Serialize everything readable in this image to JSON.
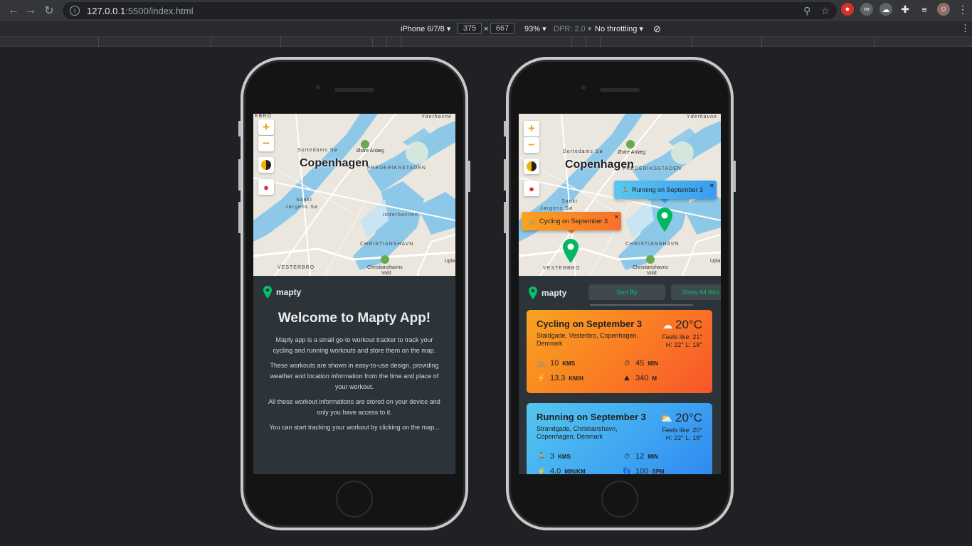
{
  "browser": {
    "url_host": "127.0.0.1",
    "url_rest": ":5500/index.html"
  },
  "devtools": {
    "device": "iPhone 6/7/8",
    "width": "375",
    "times": "×",
    "height": "667",
    "zoom": "93%",
    "dpr": "DPR: 2.0",
    "throttling": "No throttling"
  },
  "map": {
    "city": "Copenhagen",
    "zoom_in": "+",
    "zoom_out": "−",
    "labels": {
      "sortedams": "Sortedams Sø",
      "ostre": "Østre Anlæg",
      "frederiks": "FREDERIKSSTADEN",
      "sankt": "Sankt",
      "jorgens": "Jørgens Sø",
      "indre": "Inderhavnen",
      "christianshavn": "CHRISTIANSHAVN",
      "vesterbro": "VESTERBRO",
      "christianshavns": "Christianshavns",
      "vold": "Vold",
      "yderhavn": "Yderhavne",
      "upla": "Upla",
      "ebro": "EBRO"
    }
  },
  "app": {
    "logo": "mapty",
    "welcome_title": "Welcome to Mapty App!",
    "paragraphs": [
      "Mapty app is a small go-to workout tracker to track your cycling and running workouts and store them on the map.",
      "These workouts are shown in easy-to-use design, providing weather and location information from the time and place of your workout.",
      "All these workout informations are stored on your device and only you have access to it.",
      "You can start tracking your workout by clicking on the map..."
    ],
    "sort_by": "Sort By",
    "show_all": "Show All Wor"
  },
  "popups": {
    "running": "Running on September 3",
    "cycling": "Cycling on September 3",
    "close": "×"
  },
  "workouts": [
    {
      "title": "Cycling on September 3",
      "address": "Staldgade, Vesterbro, Copenhagen, Denmark",
      "temp": "20°C",
      "feels": "Feels like: 21°",
      "hl": "H: 22° L: 18°",
      "distance": "10",
      "distance_unit": "KMS",
      "duration": "45",
      "duration_unit": "MIN",
      "speed": "13.3",
      "speed_unit": "KM/H",
      "elev": "340",
      "elev_unit": "M"
    },
    {
      "title": "Running on September 3",
      "address": "Strandgade, Christianshavn, Copenhagen, Denmark",
      "temp": "20°C",
      "feels": "Feels like: 20°",
      "hl": "H: 22° L: 18°",
      "distance": "3",
      "distance_unit": "KMS",
      "duration": "12",
      "duration_unit": "MIN",
      "pace": "4.0",
      "pace_unit": "MIN/KM",
      "cadence": "100",
      "cadence_unit": "SPM"
    }
  ],
  "colors": {
    "accent": "#00c46a",
    "cycling": "#f8a41f",
    "running": "#53c6ee",
    "water": "#8ec8e8"
  }
}
